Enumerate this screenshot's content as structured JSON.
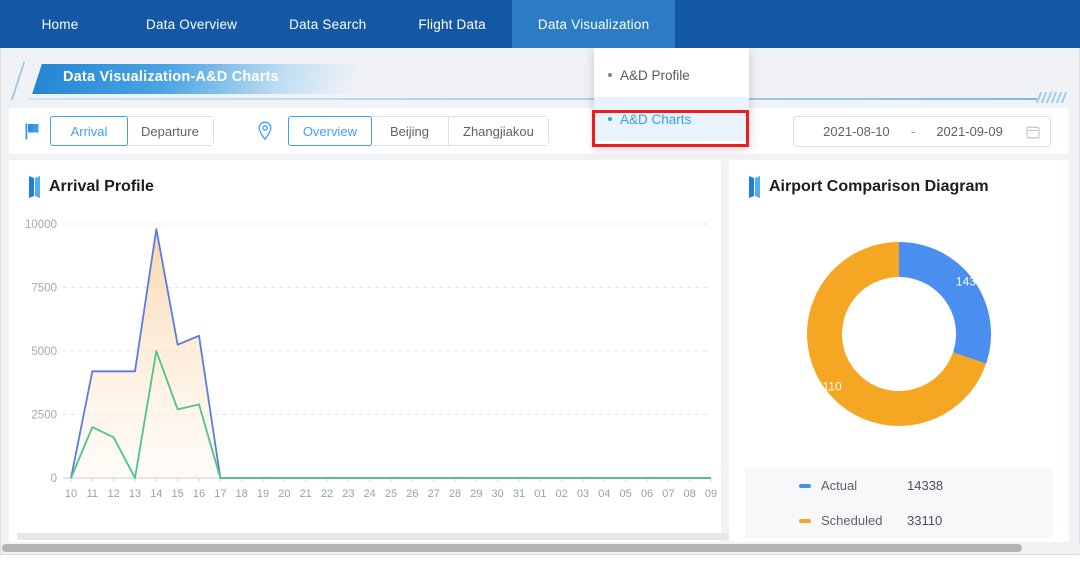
{
  "nav": {
    "items": [
      {
        "label": "Home",
        "active": false
      },
      {
        "label": "Data Overview",
        "active": false
      },
      {
        "label": "Data Search",
        "active": false
      },
      {
        "label": "Flight Data",
        "active": false
      },
      {
        "label": "Data Visualization",
        "active": true
      }
    ]
  },
  "dropdown": {
    "items": [
      {
        "label": "A&D Profile",
        "selected": false
      },
      {
        "label": "A&D Charts",
        "selected": true
      }
    ],
    "highlight_color": "#ee1c1c"
  },
  "banner": {
    "title": "Data Visualization-A&D Charts"
  },
  "toolbar": {
    "direction": {
      "options": [
        {
          "label": "Arrival",
          "active": true
        },
        {
          "label": "Departure",
          "active": false
        }
      ]
    },
    "airport": {
      "options": [
        {
          "label": "Overview",
          "active": true
        },
        {
          "label": "Beijing",
          "active": false
        },
        {
          "label": "Zhangjiakou",
          "active": false
        }
      ]
    },
    "date_range": {
      "start": "2021-08-10",
      "separator": "-",
      "end": "2021-09-09"
    }
  },
  "panels": {
    "left_title": "Arrival Profile",
    "right_title": "Airport Comparison Diagram"
  },
  "legend": {
    "rows": [
      {
        "name": "Actual",
        "value": "14338",
        "color": "#4a8ef0"
      },
      {
        "name": "Scheduled",
        "value": "33110",
        "color": "#f5a623"
      }
    ]
  },
  "chart_data": [
    {
      "type": "area",
      "title": "Arrival Profile",
      "xlabel": "",
      "ylabel": "",
      "ylim": [
        0,
        10000
      ],
      "yticks": [
        0,
        2500,
        5000,
        7500,
        10000
      ],
      "grid": true,
      "legend_position": "none",
      "categories": [
        "10",
        "11",
        "12",
        "13",
        "14",
        "15",
        "16",
        "17",
        "18",
        "19",
        "20",
        "21",
        "22",
        "23",
        "24",
        "25",
        "26",
        "27",
        "28",
        "29",
        "30",
        "31",
        "01",
        "02",
        "03",
        "04",
        "05",
        "06",
        "07",
        "08",
        "09"
      ],
      "series": [
        {
          "name": "Scheduled",
          "color": "#5b7ce0",
          "values": [
            0,
            4200,
            4200,
            4200,
            9800,
            5250,
            5600,
            0,
            0,
            0,
            0,
            0,
            0,
            0,
            0,
            0,
            0,
            0,
            0,
            0,
            0,
            0,
            0,
            0,
            0,
            0,
            0,
            0,
            0,
            0,
            0
          ]
        },
        {
          "name": "Actual",
          "color": "#4ec48a",
          "values": [
            0,
            2000,
            1600,
            0,
            5000,
            2700,
            2900,
            0,
            0,
            0,
            0,
            0,
            0,
            0,
            0,
            0,
            0,
            0,
            0,
            0,
            0,
            0,
            0,
            0,
            0,
            0,
            0,
            0,
            0,
            0,
            0
          ]
        }
      ]
    },
    {
      "type": "pie",
      "title": "Airport Comparison Diagram",
      "subtype": "donut",
      "labels": [
        "Actual",
        "Scheduled"
      ],
      "values": [
        14338,
        33110
      ],
      "colors": [
        "#4a8ef0",
        "#f5a623"
      ],
      "data_labels": [
        "14338",
        "33110"
      ],
      "legend_position": "bottom"
    }
  ]
}
